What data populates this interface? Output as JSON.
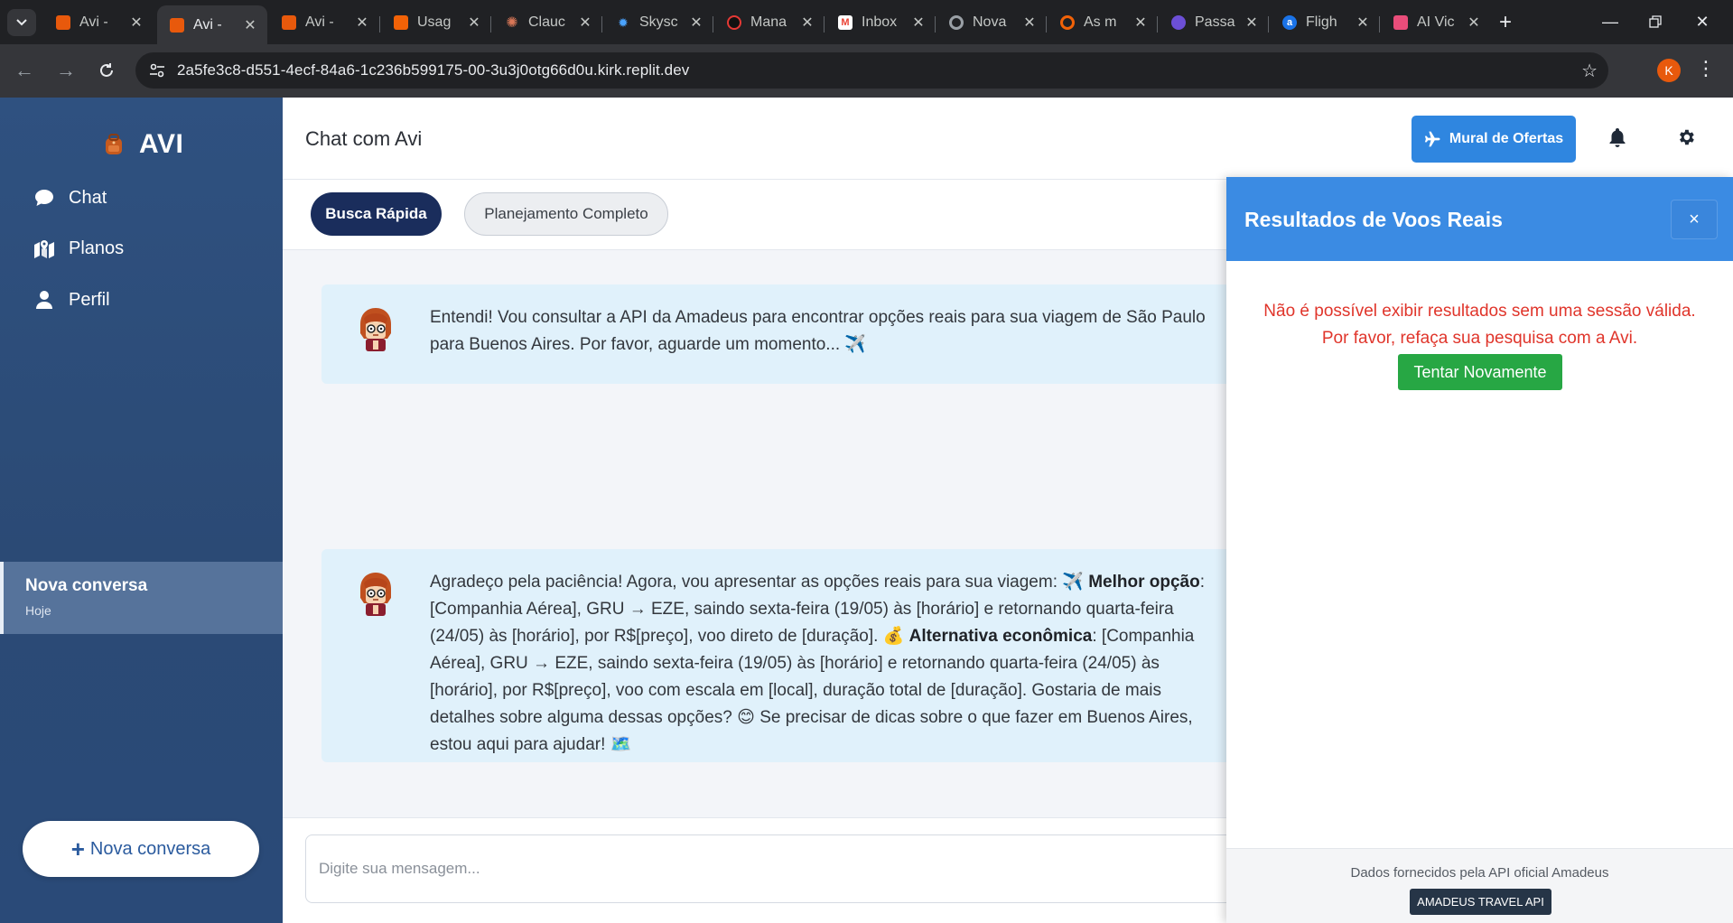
{
  "browser": {
    "tabs": [
      {
        "title": "Avi -",
        "favicon": "avi-icon",
        "color": "#e8590c"
      },
      {
        "title": "Avi -",
        "favicon": "avi-icon",
        "color": "#e8590c",
        "active": true
      },
      {
        "title": "Avi -",
        "favicon": "avi-icon",
        "color": "#e8590c"
      },
      {
        "title": "Usag",
        "favicon": "replit-icon",
        "color": "#f26207"
      },
      {
        "title": "Clauc",
        "favicon": "claude-icon",
        "color": "#d97757"
      },
      {
        "title": "Skysc",
        "favicon": "skyscanner-icon",
        "color": "#0770e3"
      },
      {
        "title": "Mana",
        "favicon": "manager-icon",
        "color": "#e53935"
      },
      {
        "title": "Inbox",
        "favicon": "gmail-icon",
        "color": "#ea4335"
      },
      {
        "title": "Nova",
        "favicon": "chrome-icon",
        "color": "#9aa0a6"
      },
      {
        "title": "As m",
        "favicon": "opera-icon",
        "color": "#f26207"
      },
      {
        "title": "Passa",
        "favicon": "moon-icon",
        "color": "#6c4fd6"
      },
      {
        "title": "Fligh",
        "favicon": "amadeus-a-icon",
        "color": "#1a73e8"
      },
      {
        "title": "AI Vic",
        "favicon": "ai-icon",
        "color": "#e94d7a"
      }
    ],
    "url": "2a5fe3c8-d551-4ecf-84a6-1c236b599175-00-3u3j0otg66d0u.kirk.replit.dev",
    "profile_initial": "K"
  },
  "sidebar": {
    "brand": "AVI",
    "nav": [
      {
        "label": "Chat"
      },
      {
        "label": "Planos"
      },
      {
        "label": "Perfil"
      }
    ],
    "conversation": {
      "title": "Nova conversa",
      "date": "Hoje"
    },
    "new_conversation_label": "Nova conversa"
  },
  "header": {
    "title": "Chat com Avi",
    "mural_label": "Mural de Ofertas"
  },
  "modes": {
    "quick": "Busca Rápida",
    "full": "Planejamento Completo"
  },
  "messages": [
    {
      "text": "Entendi! Vou consultar a API da Amadeus para encontrar opções reais para sua viagem de São Paulo para Buenos Aires. Por favor, aguarde um momento... ✈️"
    },
    {
      "parts": {
        "p1": "Agradeço pela paciência! Agora, vou apresentar as opções reais para sua viagem: ✈️ ",
        "b1": "Melhor opção",
        "p2": ": [Companhia Aérea], GRU → EZE, saindo sexta-feira (19/05) às [horário] e retornando quarta-feira (24/05) às [horário], por R$[preço], voo direto de [duração]. 💰 ",
        "b2": "Alternativa econômica",
        "p3": ": [Companhia Aérea], GRU → EZE, saindo sexta-feira (19/05) às [horário] e retornando quarta-feira (24/05) às [horário], por R$[preço], voo com escala em [local], duração total de [duração]. Gostaria de mais detalhes sobre alguma dessas opções? 😊 Se precisar de dicas sobre o que fazer em Buenos Aires, estou aqui para ajudar! 🗺️"
      }
    }
  ],
  "input": {
    "placeholder": "Digite sua mensagem..."
  },
  "panel": {
    "title": "Resultados de Voos Reais",
    "close": "×",
    "error_line1": "Não é possível exibir resultados sem uma sessão válida.",
    "error_line2": "Por favor, refaça sua pesquisa com a Avi.",
    "retry": "Tentar Novamente",
    "footer": "Dados fornecidos pela API oficial Amadeus",
    "badge": "AMADEUS TRAVEL API"
  },
  "colors": {
    "sidebar": "#2b4a75",
    "accent": "#3b8be3",
    "mode_active": "#1a2d5c",
    "error": "#e0352b",
    "retry": "#27a744"
  }
}
